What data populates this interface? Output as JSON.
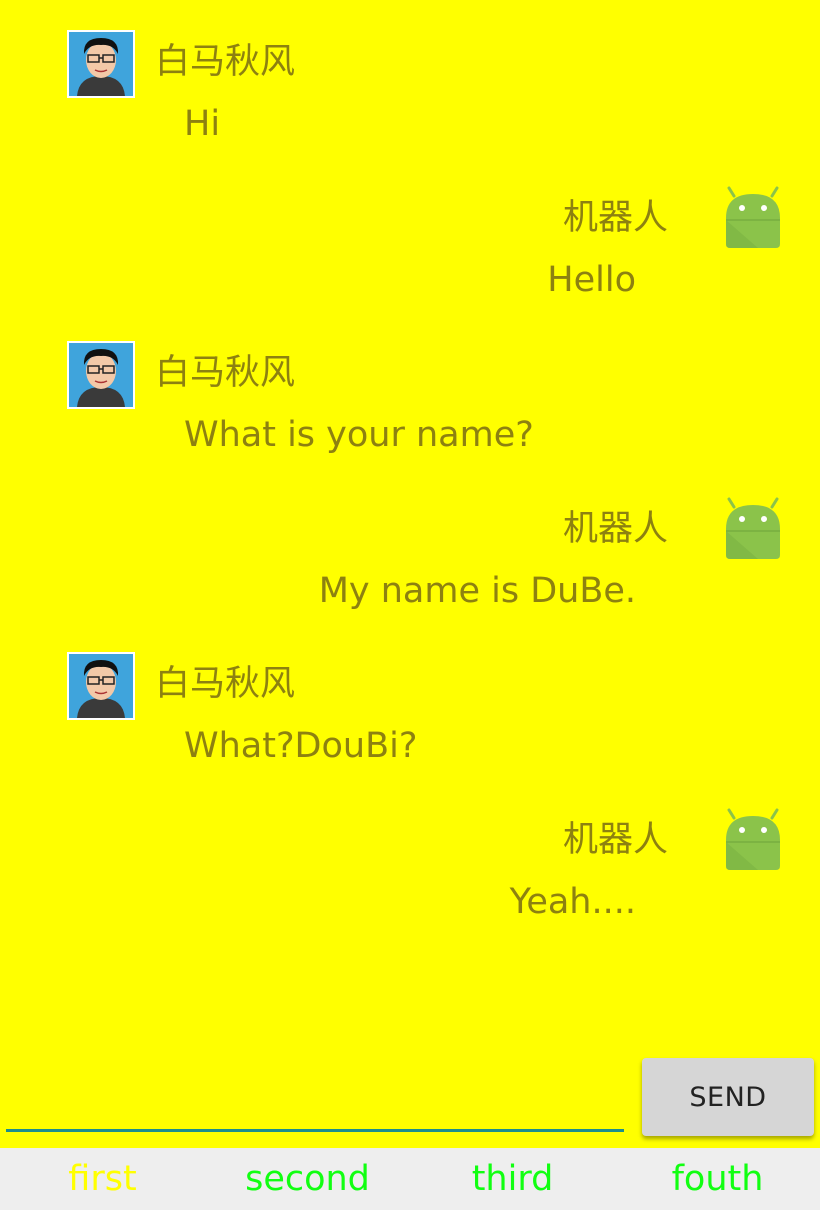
{
  "messages": [
    {
      "sender": "user",
      "name": "白马秋风",
      "text": "Hi"
    },
    {
      "sender": "bot",
      "name": "机器人",
      "text": "Hello"
    },
    {
      "sender": "user",
      "name": "白马秋风",
      "text": "What is your name?"
    },
    {
      "sender": "bot",
      "name": "机器人",
      "text": "My name is DuBe."
    },
    {
      "sender": "user",
      "name": "白马秋风",
      "text": "What?DouBi?"
    },
    {
      "sender": "bot",
      "name": "机器人",
      "text": "Yeah...."
    }
  ],
  "composer": {
    "value": "",
    "send_label": "SEND"
  },
  "tabs": [
    {
      "label": "first",
      "active": true
    },
    {
      "label": "second",
      "active": false
    },
    {
      "label": "third",
      "active": false
    },
    {
      "label": "fouth",
      "active": false
    }
  ],
  "colors": {
    "background": "#ffff00",
    "message_text": "#8d8110",
    "tab_text": "#11ff11",
    "tab_active": "#ffff00",
    "input_underline": "#1e8e8c",
    "android_green": "#8bc34a"
  },
  "icons": {
    "user_avatar": "user-avatar",
    "bot_avatar": "android-robot-icon"
  }
}
